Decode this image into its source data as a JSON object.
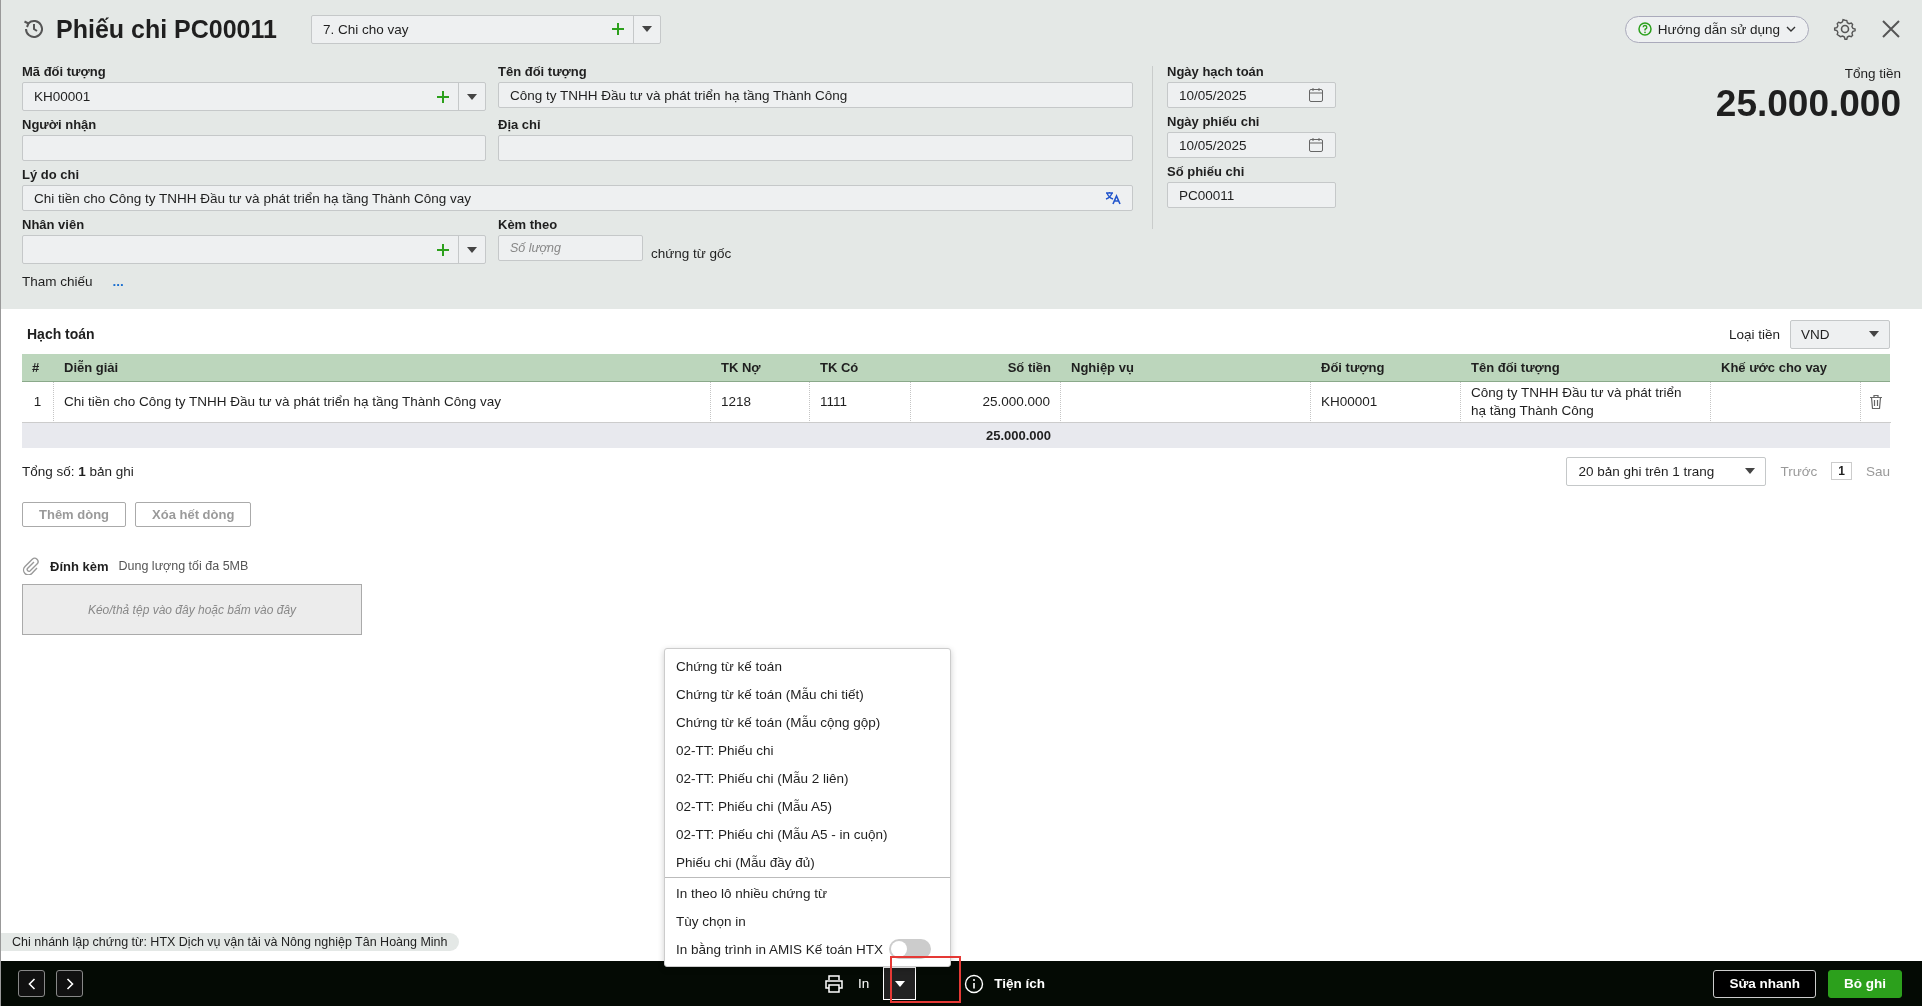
{
  "header": {
    "title": "Phiếu chi PC00011",
    "type_select": "7. Chi cho vay",
    "help_button": "Hướng dẫn sử dụng"
  },
  "form": {
    "object_code": {
      "label": "Mã đối tượng",
      "value": "KH00001"
    },
    "object_name": {
      "label": "Tên đối tượng",
      "value": "Công ty TNHH Đầu tư và phát triển hạ tầng Thành Công"
    },
    "recipient": {
      "label": "Người nhận"
    },
    "address": {
      "label": "Địa chỉ"
    },
    "reason": {
      "label": "Lý do chi",
      "value": "Chi tiền cho Công ty TNHH Đầu tư và phát triển hạ tầng Thành Công vay"
    },
    "employee": {
      "label": "Nhân viên"
    },
    "attached": {
      "label": "Kèm theo",
      "placeholder": "Số lượng",
      "suffix": "chứng từ gốc"
    },
    "reference": {
      "label": "Tham chiếu",
      "link": "..."
    },
    "posting_date": {
      "label": "Ngày hạch toán",
      "value": "10/05/2025"
    },
    "voucher_date": {
      "label": "Ngày phiếu chi",
      "value": "10/05/2025"
    },
    "voucher_no": {
      "label": "Số phiếu chi",
      "value": "PC00011"
    }
  },
  "total": {
    "label": "Tổng tiền",
    "value": "25.000.000"
  },
  "accounting": {
    "title": "Hạch toán",
    "currency": {
      "label": "Loại tiền",
      "value": "VND"
    },
    "table": {
      "columns": [
        {
          "label": "#",
          "numeric": false
        },
        {
          "label": "Diễn giải",
          "numeric": false
        },
        {
          "label": "TK Nợ",
          "numeric": false
        },
        {
          "label": "TK Có",
          "numeric": false
        },
        {
          "label": "Số tiền",
          "numeric": true
        },
        {
          "label": "Nghiệp vụ",
          "numeric": false
        },
        {
          "label": "Đối tượng",
          "numeric": false
        },
        {
          "label": "Tên đối tượng",
          "numeric": false
        },
        {
          "label": "Khế ước cho vay",
          "numeric": false
        }
      ],
      "rows": [
        {
          "cells": [
            "1",
            "Chi tiền cho Công ty TNHH Đầu tư và phát triển hạ tầng Thành Công vay",
            "1218",
            "1111",
            "25.000.000",
            null,
            "KH00001",
            "Công ty TNHH Đầu tư và phát triển hạ tầng Thành Công",
            null
          ]
        }
      ],
      "total_amount": "25.000.000"
    },
    "record_count": "Tổng số: **1** bản ghi",
    "pagination": {
      "page_size": "20 bản ghi trên 1 trang",
      "prev": {
        "label": "Trước",
        "disabled": true
      },
      "page": "1",
      "next": {
        "label": "Sau",
        "disabled": true
      }
    },
    "buttons": [
      {
        "label": "Thêm dòng",
        "disabled": true
      },
      {
        "label": "Xóa hết dòng",
        "disabled": true
      }
    ]
  },
  "attachments": {
    "title": "Đính kèm",
    "hint": "Dung lượng tối đa 5MB",
    "dropzone": "Kéo/thả tệp vào đây hoặc bấm vào đây"
  },
  "branch": "Chi nhánh lập chứng từ: HTX Dịch vụ vận tải và Nông nghiệp Tân Hoàng Minh",
  "print_menu": {
    "templates": [
      "Chứng từ kế toán",
      "Chứng từ kế toán (Mẫu chi tiết)",
      "Chứng từ kế toán (Mẫu cộng gộp)",
      "02-TT: Phiếu chi",
      "02-TT: Phiếu chi (Mẫu 2 liên)",
      "02-TT: Phiếu chi (Mẫu A5)",
      "02-TT: Phiếu chi (Mẫu A5 - in cuộn)",
      "Phiếu chi (Mẫu đầy đủ)"
    ],
    "options": [
      {
        "kind": "item",
        "label": "In theo lô nhiều chứng từ"
      },
      {
        "kind": "item",
        "label": "Tùy chọn in"
      },
      {
        "kind": "toggle",
        "label": "In bằng trình in AMIS Kế toán HTX",
        "on": false
      }
    ]
  },
  "toolbar": {
    "print": "In",
    "utilities": "Tiện ích",
    "buttons": [
      {
        "kind": "secondary",
        "label": "Sửa nhanh"
      },
      {
        "kind": "primary",
        "label": "Bỏ ghi"
      }
    ]
  }
}
